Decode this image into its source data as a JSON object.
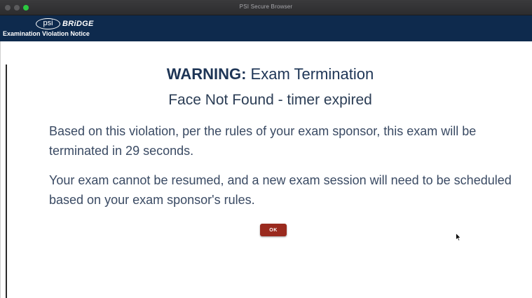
{
  "window": {
    "title": "PSI Secure Browser"
  },
  "header": {
    "logo_psi": "psi",
    "logo_bridge": "BRiDGE",
    "title": "Examination Violation Notice"
  },
  "notice": {
    "warning_label": "WARNING:",
    "warning_text": " Exam Termination",
    "subtitle": "Face Not Found - timer expired",
    "paragraph_1": "Based on this violation, per the rules of your exam sponsor, this exam will be terminated in 29 seconds.",
    "paragraph_2": "Your exam cannot be resumed, and a new exam session will need to be scheduled based on your exam sponsor's rules.",
    "ok_label": "OK"
  },
  "colors": {
    "header_bg": "#0e2a4d",
    "button_bg": "#9a2a1e",
    "text_primary": "#1e3556"
  }
}
